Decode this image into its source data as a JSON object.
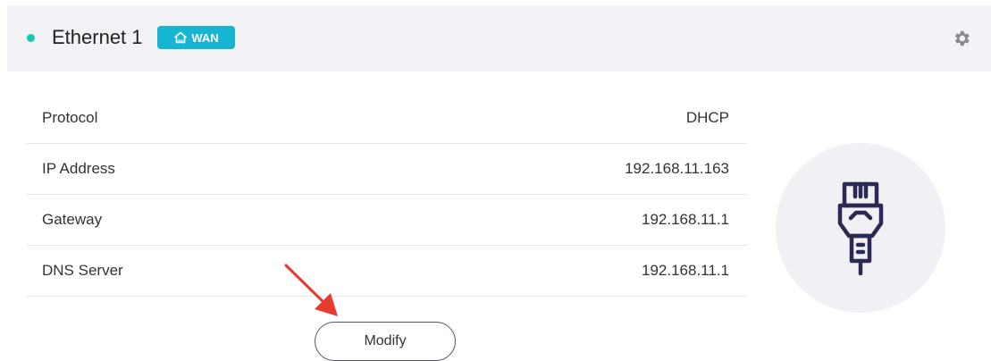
{
  "header": {
    "title": "Ethernet 1",
    "badge": "WAN",
    "status_color": "#1fc6b3",
    "badge_color": "#16b6d3",
    "icons": [
      "home-icon",
      "gear-icon"
    ]
  },
  "details": [
    {
      "label": "Protocol",
      "value": "DHCP"
    },
    {
      "label": "IP Address",
      "value": "192.168.11.163"
    },
    {
      "label": "Gateway",
      "value": "192.168.11.1"
    },
    {
      "label": "DNS Server",
      "value": "192.168.11.1"
    }
  ],
  "actions": {
    "modify_label": "Modify"
  },
  "illustration": {
    "icon": "ethernet-cable-icon"
  },
  "annotation": {
    "icon": "red-arrow-icon",
    "color": "#e83a2f"
  }
}
